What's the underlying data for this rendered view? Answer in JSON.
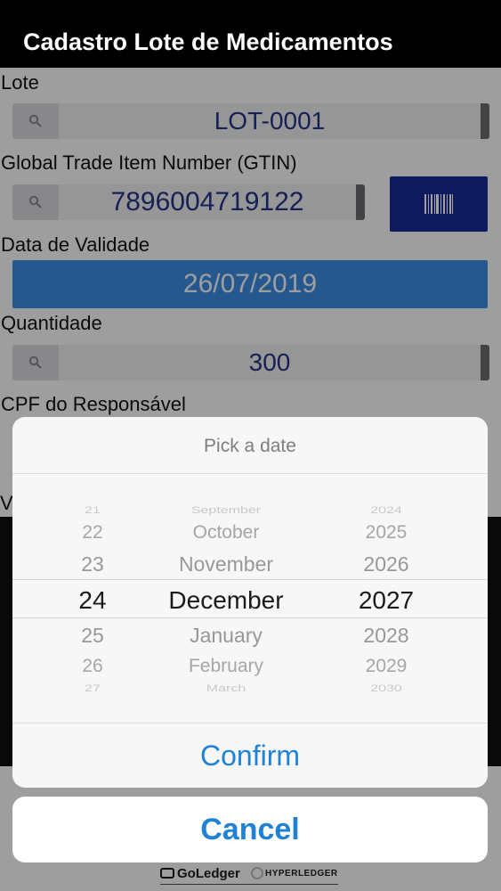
{
  "app": {
    "title": "Cadastro Lote de Medicamentos",
    "lote": {
      "label": "Lote",
      "value": "LOT-0001"
    },
    "gtin": {
      "label": "Global Trade Item Number (GTIN)",
      "value": "7896004719122"
    },
    "validade": {
      "label": "Data de Validade",
      "value": "26/07/2019"
    },
    "quantidade": {
      "label": "Quantidade",
      "value": "300"
    },
    "cpf": {
      "label": "CPF do Responsável"
    },
    "hidden_label_fragment": "V"
  },
  "picker": {
    "title": "Pick a date",
    "days": [
      "21",
      "22",
      "23",
      "24",
      "25",
      "26",
      "27"
    ],
    "months": [
      "September",
      "October",
      "November",
      "December",
      "January",
      "February",
      "March"
    ],
    "years": [
      "2024",
      "2025",
      "2026",
      "2027",
      "2028",
      "2029",
      "2030"
    ],
    "selected": {
      "day": "24",
      "month": "December",
      "year": "2027"
    },
    "confirm_label": "Confirm",
    "cancel_label": "Cancel"
  },
  "footer": {
    "goledger": "GoLedger",
    "hyperledger": "HYPERLEDGER"
  },
  "colors": {
    "accent": "#1f82d6",
    "value_text": "#24348a",
    "date_button": "#3a8ee6",
    "barcode_button": "#1a2c9a",
    "titlebar": "#000000"
  },
  "icons": [
    "search-icon",
    "barcode-icon",
    "goledger-logo",
    "hyperledger-logo"
  ]
}
